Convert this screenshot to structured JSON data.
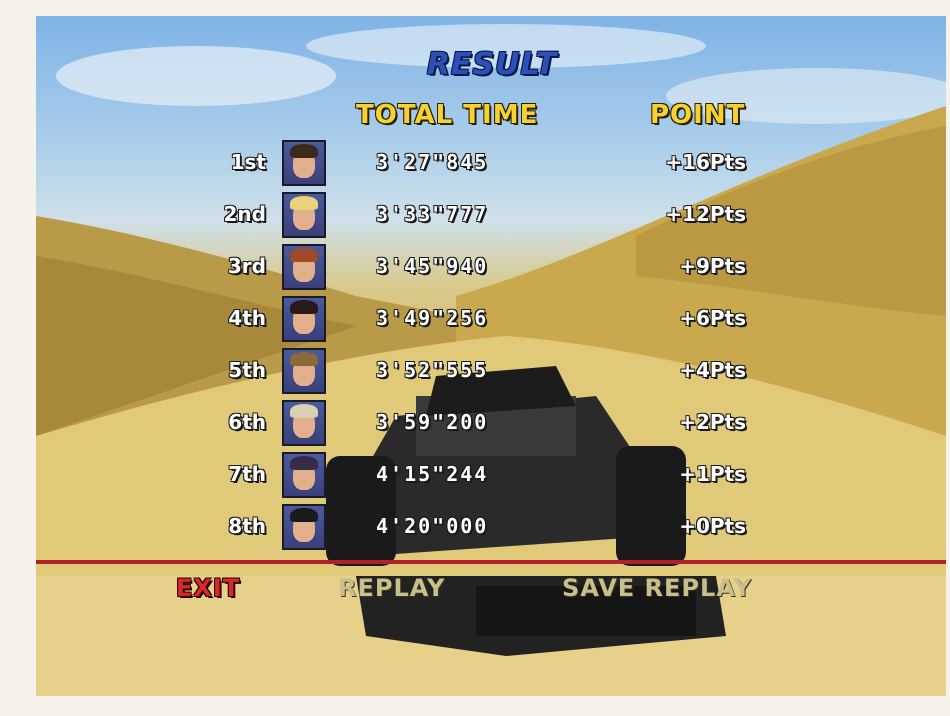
{
  "title": "RESULT",
  "headers": {
    "time": "TOTAL TIME",
    "points": "POINT"
  },
  "rows": [
    {
      "place": "1st",
      "time": "3'27\"845",
      "points": "+16Pts"
    },
    {
      "place": "2nd",
      "time": "3'33\"777",
      "points": "+12Pts"
    },
    {
      "place": "3rd",
      "time": "3'45\"940",
      "points": "+9Pts"
    },
    {
      "place": "4th",
      "time": "3'49\"256",
      "points": "+6Pts"
    },
    {
      "place": "5th",
      "time": "3'52\"555",
      "points": "+4Pts"
    },
    {
      "place": "6th",
      "time": "3'59\"200",
      "points": "+2Pts"
    },
    {
      "place": "7th",
      "time": "4'15\"244",
      "points": "+1Pts"
    },
    {
      "place": "8th",
      "time": "4'20\"000",
      "points": "+0Pts"
    }
  ],
  "menu": {
    "exit": "EXIT",
    "replay": "REPLAY",
    "save_replay": "SAVE REPLAY"
  },
  "colors": {
    "title": "#2d4fb8",
    "header": "#f5d232",
    "exit_selected": "#d62a2a",
    "menu_inactive": "#c9bf8a",
    "divider": "#b3202a"
  },
  "portraits": [
    "driver-portrait-1",
    "driver-portrait-2",
    "driver-portrait-3",
    "driver-portrait-4",
    "driver-portrait-5",
    "driver-portrait-6",
    "driver-portrait-7",
    "driver-portrait-8"
  ]
}
